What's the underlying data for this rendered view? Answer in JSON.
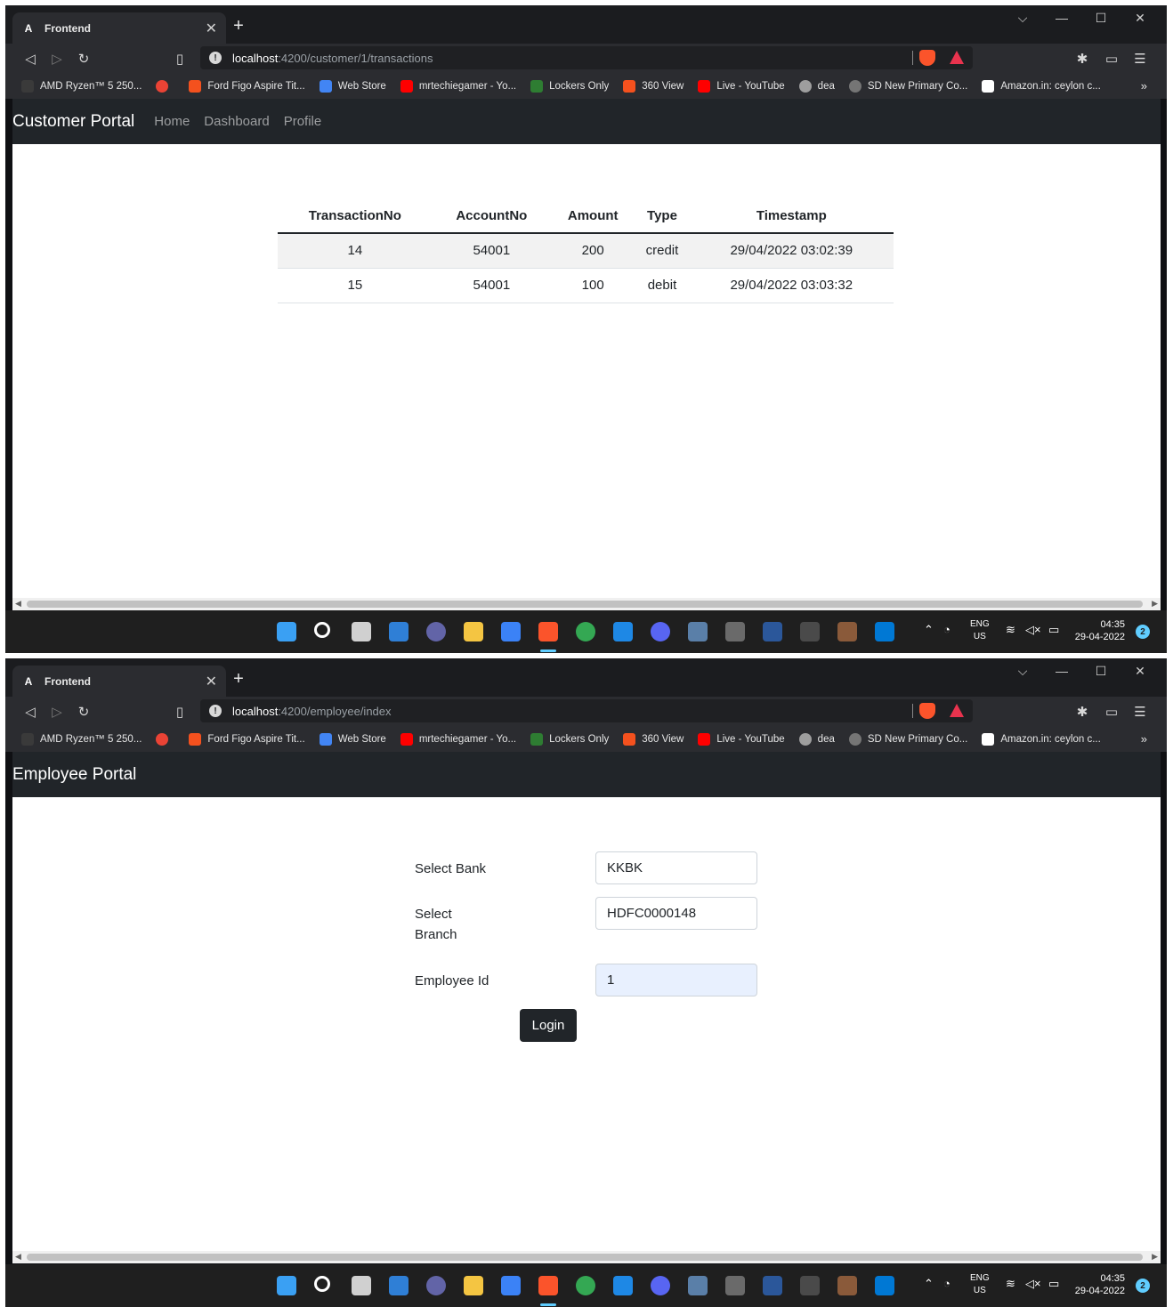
{
  "browser": {
    "tab_title": "Frontend",
    "tab_favicon": "A",
    "close_glyph": "✕",
    "newtab_glyph": "+",
    "bookmarks": [
      {
        "label": "AMD Ryzen™ 5 250...",
        "color": "#3a3a3a"
      },
      {
        "label": "",
        "color": "#ea4335"
      },
      {
        "label": "Ford Figo Aspire Tit...",
        "color": "#f4511e"
      },
      {
        "label": "Web Store",
        "color": "#4285f4"
      },
      {
        "label": "mrtechiegamer - Yo...",
        "color": "#ff0000"
      },
      {
        "label": "Lockers Only",
        "color": "#2e7d32"
      },
      {
        "label": "360 View",
        "color": "#f4511e"
      },
      {
        "label": "Live - YouTube",
        "color": "#ff0000"
      },
      {
        "label": "dea",
        "color": "#9e9e9e"
      },
      {
        "label": "SD New Primary Co...",
        "color": "#757575"
      },
      {
        "label": "Amazon.in: ceylon c...",
        "color": "#ffffff"
      }
    ],
    "more_glyph": "»"
  },
  "customer": {
    "url_host": "localhost",
    "url_path": ":4200/customer/1/transactions",
    "brand": "Customer Portal",
    "nav": [
      "Home",
      "Dashboard",
      "Profile"
    ],
    "table": {
      "headers": [
        "TransactionNo",
        "AccountNo",
        "Amount",
        "Type",
        "Timestamp"
      ],
      "rows": [
        [
          "14",
          "54001",
          "200",
          "credit",
          "29/04/2022 03:02:39"
        ],
        [
          "15",
          "54001",
          "100",
          "debit",
          "29/04/2022 03:03:32"
        ]
      ]
    }
  },
  "employee": {
    "url_host": "localhost",
    "url_path": ":4200/employee/index",
    "brand": "Employee Portal",
    "form": {
      "bank_label": "Select Bank",
      "bank_value": "KKBK",
      "branch_label_1": "Select",
      "branch_label_2": "Branch",
      "branch_value": "HDFC0000148",
      "employee_label": "Employee Id",
      "employee_value": "1",
      "login_label": "Login"
    }
  },
  "taskbar": {
    "lang_1": "ENG",
    "lang_2": "US",
    "time": "04:35",
    "date": "29-04-2022",
    "notifications": "2"
  },
  "colors": {
    "accent": "#60cdff",
    "navbar": "#212529",
    "brave": "#fb542b"
  }
}
